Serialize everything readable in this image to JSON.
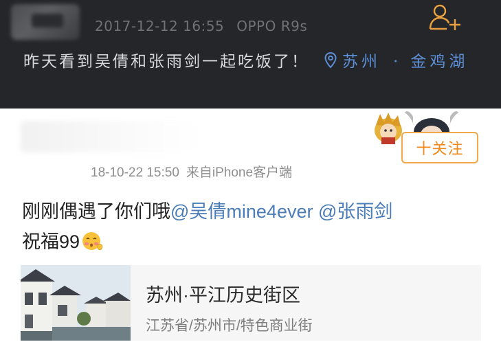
{
  "post1": {
    "timestamp": "2017-12-12 16:55",
    "device": "OPPO R9s",
    "text": "昨天看到吴倩和张雨剑一起吃饭了！",
    "location_city": "苏州",
    "location_dot": "·",
    "location_place": "金鸡湖",
    "follow_icon": "add-user-icon"
  },
  "post2": {
    "follow_label": "十关注",
    "timestamp": "18-10-22 15:50",
    "source": "来自iPhone客户端",
    "text_prefix": "刚刚偶遇了你们哦",
    "mention1": "@吴倩mine4ever",
    "mention2": "@张雨剑",
    "text_suffix": "祝福99",
    "emoji": "blushing-face",
    "location_title": "苏州·平江历史街区",
    "location_subtitle": "江苏省/苏州市/特色商业街"
  },
  "colors": {
    "dark_bg": "#24262a",
    "link_blue_dark": "#5d8fd6",
    "follow_orange": "#f08a1c",
    "mention_blue": "#4a7cb8"
  }
}
